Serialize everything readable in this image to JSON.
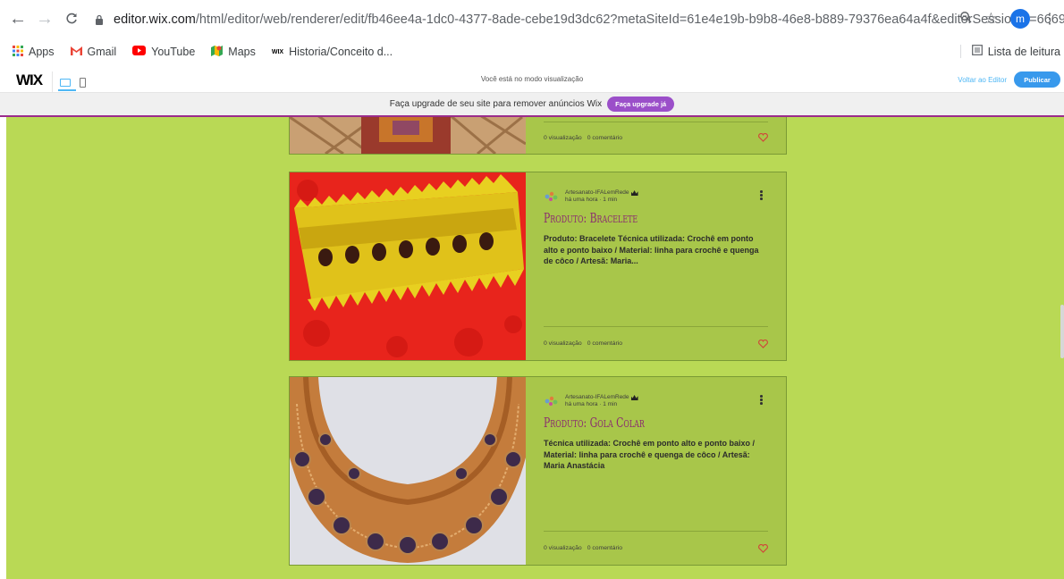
{
  "browser": {
    "url_host": "editor.wix.com",
    "url_path": "/html/editor/web/renderer/edit/fb46ee4a-1dc0-4377-8ade-cebe19d3dc62?metaSiteId=61e4e19b-b9b8-46e8-b889-79376ea64a4f&editorSessionId=666933d...",
    "avatar_letter": "m",
    "bookmarks": [
      {
        "label": "Apps",
        "icon": "apps-grid-icon"
      },
      {
        "label": "Gmail",
        "icon": "gmail-icon"
      },
      {
        "label": "YouTube",
        "icon": "youtube-icon"
      },
      {
        "label": "Maps",
        "icon": "maps-icon"
      },
      {
        "label": "Historia/Conceito d...",
        "icon": "wix-icon"
      }
    ],
    "reading_list": "Lista de leitura"
  },
  "wix_bar": {
    "logo": "WIX",
    "preview_message": "Você está no modo visualização",
    "back_to_editor": "Voltar ao Editor",
    "publish": "Publicar"
  },
  "upgrade": {
    "message": "Faça upgrade de seu site para remover anúncios Wix",
    "button": "Faça upgrade já"
  },
  "posts": [
    {
      "views": "0 visualização",
      "comments": "0 comentário"
    },
    {
      "author": "Artesanato-IFALemRede",
      "meta": "há uma hora · 1 min",
      "title": "Produto: Bracelete",
      "excerpt": "Produto: Bracelete Técnica utilizada: Crochê em ponto alto e ponto baixo / Material: linha para crochê e quenga de côco / Artesã: Maria...",
      "views": "0 visualização",
      "comments": "0 comentário"
    },
    {
      "author": "Artesanato-IFALemRede",
      "meta": "há uma hora · 1 min",
      "title": "Produto: Gola Colar",
      "excerpt": "Técnica utilizada: Crochê em ponto alto e ponto baixo / Material: linha para crochê e quenga de côco / Artesã: Maria Anastácia",
      "views": "0 visualização",
      "comments": "0 comentário"
    }
  ],
  "colors": {
    "page_bg": "#b9d955",
    "card_bg": "#a8c64a",
    "title": "#8b2d6f",
    "heart": "#d0483a",
    "upgrade_accent": "#9b4fc9"
  }
}
